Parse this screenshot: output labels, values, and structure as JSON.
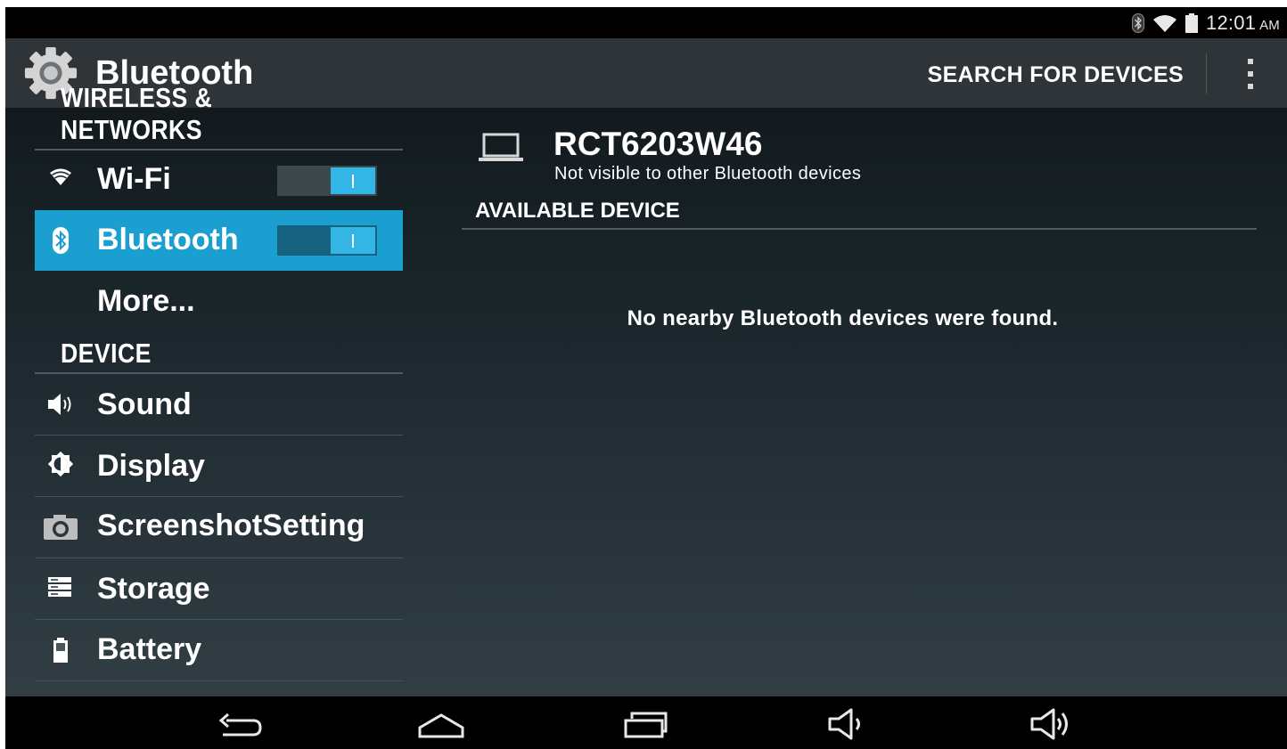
{
  "status_bar": {
    "time": "12:01",
    "ampm": "AM",
    "icons": [
      "bluetooth-icon",
      "wifi-signal-icon",
      "battery-icon"
    ]
  },
  "action_bar": {
    "icon": "settings-gear-icon",
    "title": "Bluetooth",
    "search_label": "SEARCH FOR DEVICES",
    "overflow_icon": "overflow-menu-icon"
  },
  "sidebar": {
    "sections": [
      {
        "title": "WIRELESS & NETWORKS"
      },
      {
        "title": "DEVICE"
      }
    ],
    "items": [
      {
        "label": "Wi-Fi",
        "icon": "wifi-icon",
        "toggle": "on"
      },
      {
        "label": "Bluetooth",
        "icon": "bluetooth-icon",
        "toggle": "on",
        "selected": true
      },
      {
        "label": "More..."
      },
      {
        "label": "Sound",
        "icon": "speaker-icon"
      },
      {
        "label": "Display",
        "icon": "brightness-icon"
      },
      {
        "label": "ScreenshotSetting",
        "icon": "camera-icon"
      },
      {
        "label": "Storage",
        "icon": "storage-icon"
      },
      {
        "label": "Battery",
        "icon": "battery-icon"
      }
    ]
  },
  "main": {
    "device_name": "RCT6203W46",
    "device_status": "Not visible to other Bluetooth devices",
    "available_header": "AVAILABLE DEVICE",
    "empty_message": "No nearby Bluetooth devices were found."
  },
  "nav_bar": {
    "buttons": [
      "back-icon",
      "home-icon",
      "recent-apps-icon",
      "volume-down-icon",
      "volume-up-icon"
    ]
  },
  "colors": {
    "accent": "#33b5e5",
    "selected_bg": "#1b9fd0",
    "action_bar": "#2f3438"
  }
}
